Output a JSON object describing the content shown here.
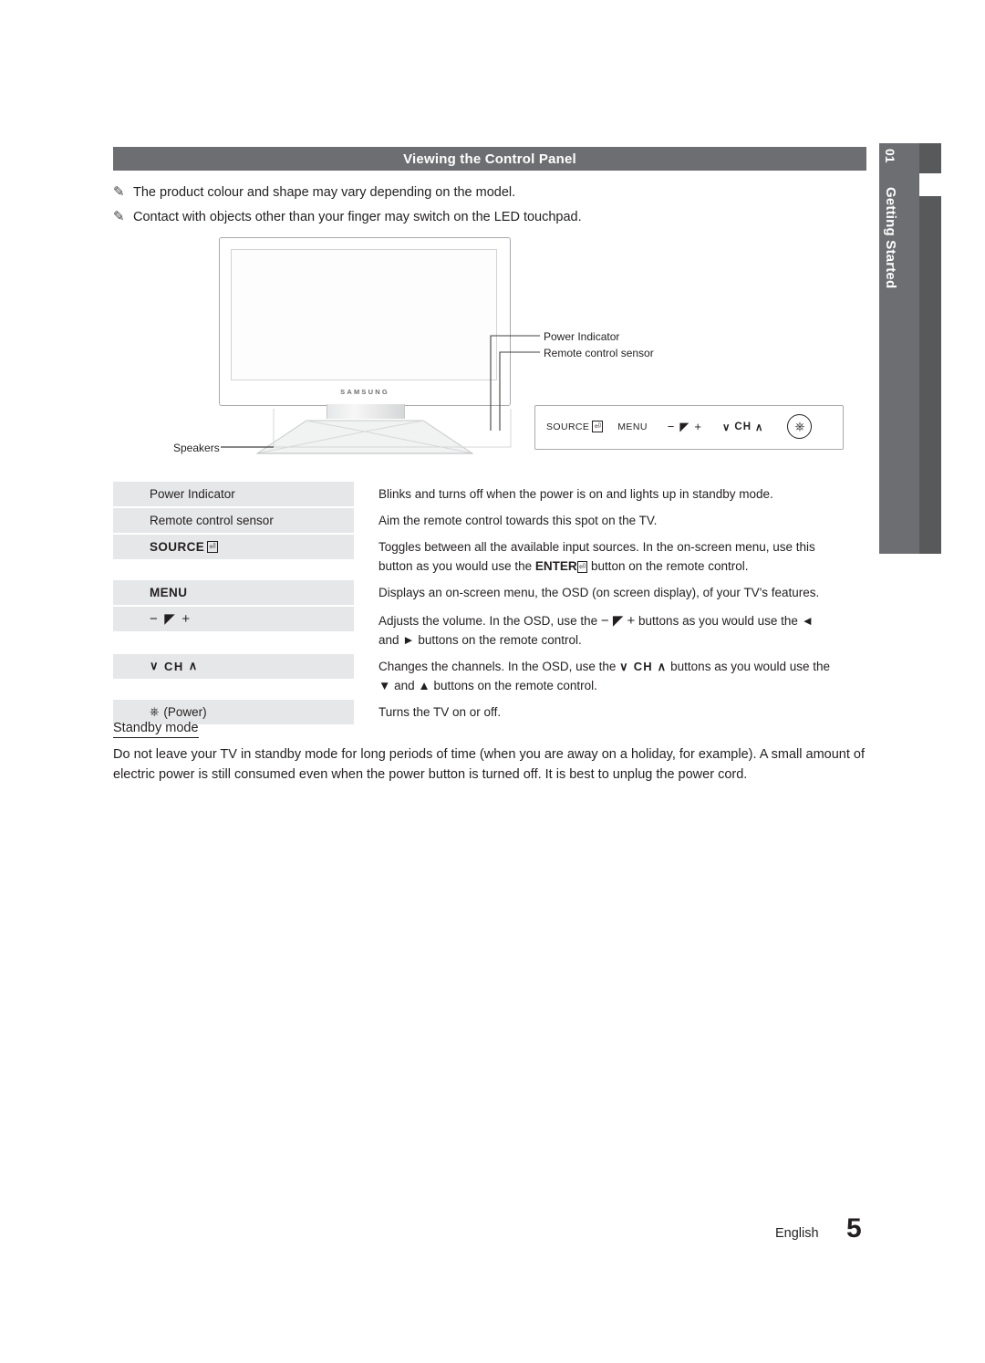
{
  "side_tab": {
    "chapter_number": "01",
    "chapter_label": "Getting Started"
  },
  "section": {
    "title": "Viewing the Control Panel"
  },
  "notes": [
    "The product colour and shape may vary depending on the model.",
    "Contact with objects other than your finger may switch on the LED touchpad."
  ],
  "diagram": {
    "brand": "SAMSUNG",
    "callouts": {
      "power_indicator": "Power Indicator",
      "remote_sensor": "Remote control sensor",
      "speakers": "Speakers"
    },
    "panel_buttons": {
      "source": "SOURCE",
      "source_icon": "enter-icon",
      "menu": "MENU",
      "volume_minus": "−",
      "volume_icon": "speaker-icon",
      "volume_plus": "+",
      "ch_down": "∨",
      "ch_label": "CH",
      "ch_up": "∧",
      "power_icon": "power-icon"
    }
  },
  "table": {
    "rows": [
      {
        "label": "Power Indicator",
        "label_type": "text",
        "description": "Blinks and turns off when the power is on and lights up in standby mode."
      },
      {
        "label": "Remote control sensor",
        "label_type": "text",
        "description": "Aim the remote control towards this spot on the TV."
      },
      {
        "label": "SOURCE",
        "label_type": "source",
        "description": "Toggles between all the available input sources. In the on-screen menu, use this button as you would use the ENTER button on the remote control."
      },
      {
        "label": "MENU",
        "label_type": "menu",
        "description": "Displays an on-screen menu, the OSD (on screen display), of your TV's features."
      },
      {
        "label": "− ◢ +",
        "label_type": "volume",
        "description": "Adjusts the volume. In the OSD, use the − ◢ + buttons as you would use the ◄ and ► buttons on the remote control."
      },
      {
        "label": "∨ CH ∧",
        "label_type": "channel",
        "description": "Changes the channels. In the OSD, use the ∨ CH ∧ buttons as you would use the ▼ and ▲ buttons on the remote control."
      },
      {
        "label": "(Power)",
        "label_type": "power",
        "description": "Turns the TV on or off."
      }
    ]
  },
  "standby": {
    "title": "Standby mode",
    "body": "Do not leave your TV in standby mode for long periods of time (when you are away on a holiday, for example). A small amount of electric power is still consumed even when the power button is turned off. It is best to unplug the power cord."
  },
  "footer": {
    "language": "English",
    "page_number": "5"
  },
  "colors": {
    "header_bar": "#6d6e71",
    "tab_dark": "#58595b",
    "row_grey": "#e6e7e8"
  }
}
